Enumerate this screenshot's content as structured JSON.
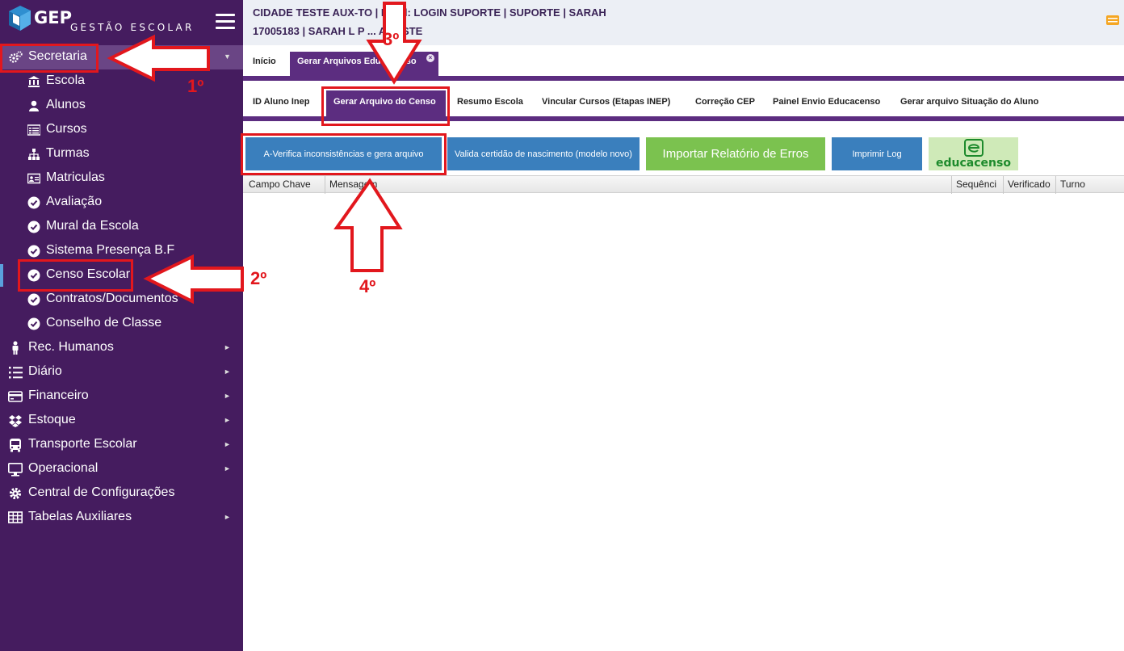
{
  "brand": {
    "name": "GEP",
    "subtitle": "GESTÃO ESCOLAR"
  },
  "header": {
    "line1": "CIDADE TESTE AUX-TO | Perfil: LOGIN SUPORTE | SUPORTE | SARAH",
    "line2": "17005183 | SARAH L P ... A TESTE"
  },
  "sidebar": {
    "secretaria": "Secretaria",
    "sub_items": [
      {
        "label": "Escola",
        "icon": "bank-icon"
      },
      {
        "label": "Alunos",
        "icon": "user-icon"
      },
      {
        "label": "Cursos",
        "icon": "list-icon"
      },
      {
        "label": "Turmas",
        "icon": "sitemap-icon"
      },
      {
        "label": "Matriculas",
        "icon": "id-card-icon"
      },
      {
        "label": "Avaliação",
        "icon": "check-circle-icon"
      },
      {
        "label": "Mural da Escola",
        "icon": "check-circle-icon"
      },
      {
        "label": "Sistema Presença B.F",
        "icon": "check-circle-icon"
      },
      {
        "label": "Censo Escolar",
        "icon": "check-circle-icon"
      },
      {
        "label": "Contratos/Documentos",
        "icon": "check-circle-icon"
      },
      {
        "label": "Conselho de Classe",
        "icon": "check-circle-icon"
      }
    ],
    "items": [
      {
        "label": "Rec. Humanos",
        "icon": "person-icon"
      },
      {
        "label": "Diário",
        "icon": "list-ol-icon"
      },
      {
        "label": "Financeiro",
        "icon": "credit-card-icon"
      },
      {
        "label": "Estoque",
        "icon": "dropbox-icon"
      },
      {
        "label": "Transporte Escolar",
        "icon": "bus-icon"
      },
      {
        "label": "Operacional",
        "icon": "desktop-icon"
      },
      {
        "label": "Central de Configurações",
        "icon": "gear-icon"
      },
      {
        "label": "Tabelas Auxiliares",
        "icon": "table-icon"
      }
    ]
  },
  "tabs": {
    "inicio": "Início",
    "gerar": "Gerar Arquivos Educacenso"
  },
  "subtabs": [
    "ID Aluno Inep",
    "Gerar Arquivo do Censo",
    "Resumo Escola",
    "Vincular Cursos (Etapas INEP)",
    "Correção CEP",
    "Painel Envio Educacenso",
    "Gerar arquivo Situação do Aluno"
  ],
  "buttons": {
    "verifica": "A-Verifica inconsistências e gera arquivo",
    "valida": "Valida certidão de nascimento (modelo novo)",
    "importar": "Importar Relatório de Erros",
    "imprimir": "Imprimir Log"
  },
  "educacenso_logo": "educacenso",
  "grid_columns": [
    "Campo Chave",
    "Mensagem",
    "Sequênci",
    "Verificado",
    "Turno"
  ],
  "annotations": [
    "1º",
    "2º",
    "3º",
    "4º"
  ],
  "colors": {
    "sidebar": "#451c5f",
    "accent": "#5c2d80",
    "annotation": "#e2171d"
  }
}
